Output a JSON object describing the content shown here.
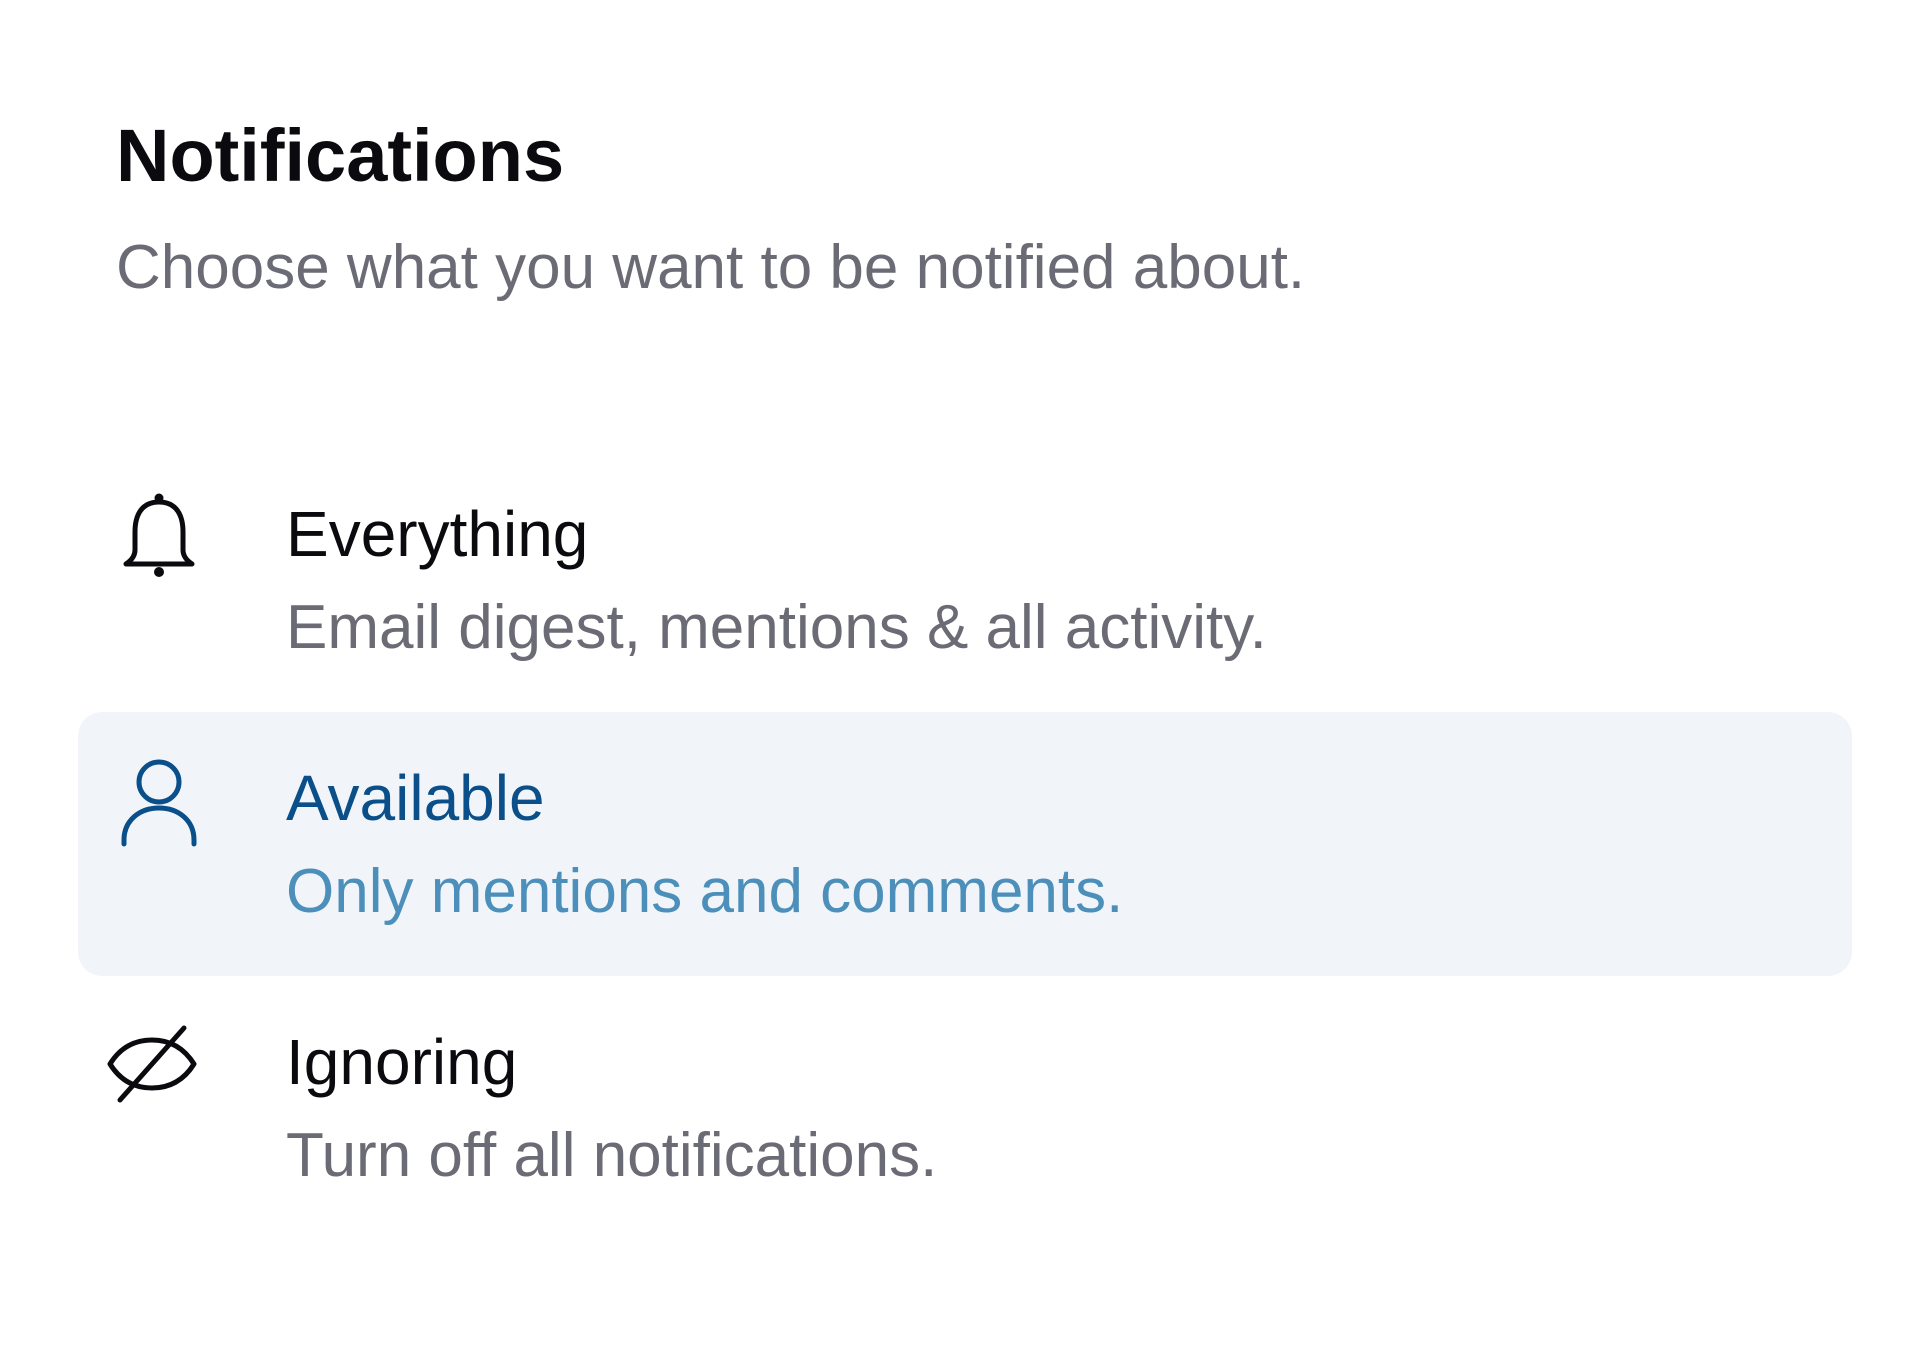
{
  "header": {
    "title": "Notifications",
    "subtitle": "Choose what you want to be notified about."
  },
  "options": [
    {
      "label": "Everything",
      "description": "Email digest, mentions & all activity.",
      "icon": "bell-icon",
      "selected": false
    },
    {
      "label": "Available",
      "description": "Only mentions and comments.",
      "icon": "user-icon",
      "selected": true
    },
    {
      "label": "Ignoring",
      "description": "Turn off all notifications.",
      "icon": "eye-off-icon",
      "selected": false
    }
  ],
  "colors": {
    "text_primary": "#0b0b0f",
    "text_secondary": "#6b6b75",
    "selected_background": "#f1f5f9",
    "selected_label": "#0b4f8a",
    "selected_description": "#4c8fba"
  }
}
